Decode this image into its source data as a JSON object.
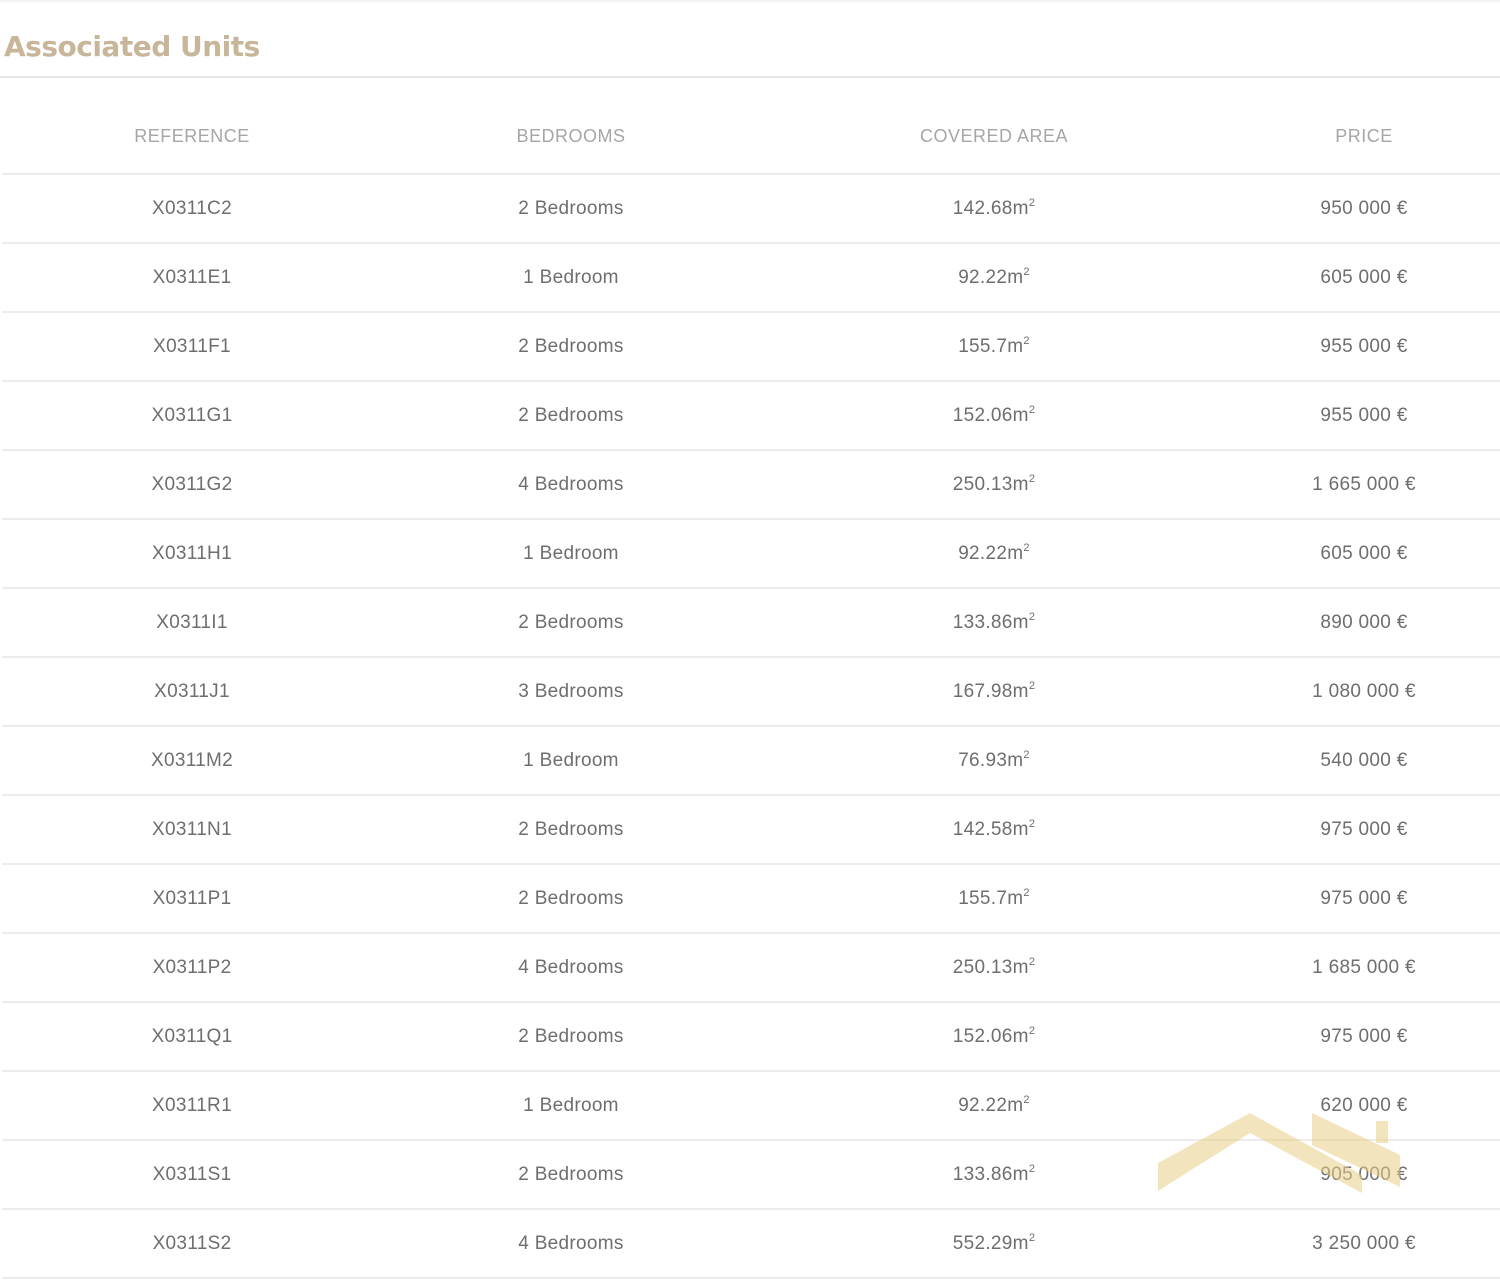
{
  "section": {
    "title": "Associated Units"
  },
  "table": {
    "headers": [
      "REFERENCE",
      "BEDROOMS",
      "COVERED AREA",
      "PRICE"
    ],
    "area_unit": "m",
    "area_unit_exp": "2",
    "rows": [
      {
        "reference": "X0311C2",
        "bedrooms": "2 Bedrooms",
        "area": "142.68",
        "price": "950 000 €"
      },
      {
        "reference": "X0311E1",
        "bedrooms": "1 Bedroom",
        "area": "92.22",
        "price": "605 000 €"
      },
      {
        "reference": "X0311F1",
        "bedrooms": "2 Bedrooms",
        "area": "155.7",
        "price": "955 000 €"
      },
      {
        "reference": "X0311G1",
        "bedrooms": "2 Bedrooms",
        "area": "152.06",
        "price": "955 000 €"
      },
      {
        "reference": "X0311G2",
        "bedrooms": "4 Bedrooms",
        "area": "250.13",
        "price": "1 665 000 €"
      },
      {
        "reference": "X0311H1",
        "bedrooms": "1 Bedroom",
        "area": "92.22",
        "price": "605 000 €"
      },
      {
        "reference": "X0311I1",
        "bedrooms": "2 Bedrooms",
        "area": "133.86",
        "price": "890 000 €"
      },
      {
        "reference": "X0311J1",
        "bedrooms": "3 Bedrooms",
        "area": "167.98",
        "price": "1 080 000 €"
      },
      {
        "reference": "X0311M2",
        "bedrooms": "1 Bedroom",
        "area": "76.93",
        "price": "540 000 €"
      },
      {
        "reference": "X0311N1",
        "bedrooms": "2 Bedrooms",
        "area": "142.58",
        "price": "975 000 €"
      },
      {
        "reference": "X0311P1",
        "bedrooms": "2 Bedrooms",
        "area": "155.7",
        "price": "975 000 €"
      },
      {
        "reference": "X0311P2",
        "bedrooms": "4 Bedrooms",
        "area": "250.13",
        "price": "1 685 000 €"
      },
      {
        "reference": "X0311Q1",
        "bedrooms": "2 Bedrooms",
        "area": "152.06",
        "price": "975 000 €"
      },
      {
        "reference": "X0311R1",
        "bedrooms": "1 Bedroom",
        "area": "92.22",
        "price": "620 000 €"
      },
      {
        "reference": "X0311S1",
        "bedrooms": "2 Bedrooms",
        "area": "133.86",
        "price": "905 000 €"
      },
      {
        "reference": "X0311S2",
        "bedrooms": "4 Bedrooms",
        "area": "552.29",
        "price": "3 250 000 €"
      }
    ]
  },
  "watermark": {
    "icon": "roof-logo-icon",
    "color": "#e8cf86"
  },
  "colors": {
    "title": "#c8b69a",
    "header_text": "#a6a6a6",
    "cell_text": "#6e6e6e",
    "rule": "#ececec"
  }
}
